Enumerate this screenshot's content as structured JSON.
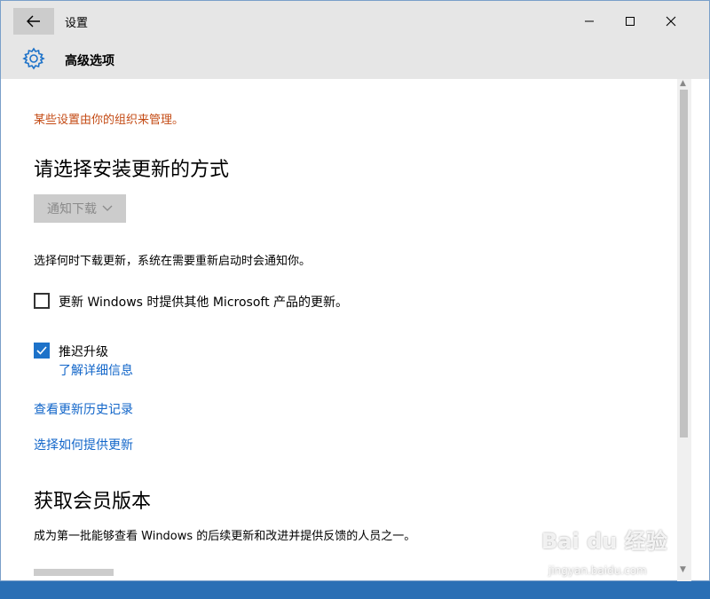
{
  "window": {
    "app_title": "设置",
    "page_title": "高级选项"
  },
  "notice": "某些设置由你的组织来管理。",
  "update_method": {
    "heading": "请选择安装更新的方式",
    "dropdown_value": "通知下载",
    "description": "选择何时下载更新，系统在需要重新启动时会通知你。"
  },
  "options": [
    {
      "label": "更新 Windows 时提供其他 Microsoft 产品的更新。",
      "checked": false
    },
    {
      "label": "推迟升级",
      "checked": true
    }
  ],
  "links": {
    "learn_more": "了解详细信息",
    "view_history": "查看更新历史记录",
    "choose_delivery": "选择如何提供更新"
  },
  "insider": {
    "heading": "获取会员版本",
    "description": "成为第一批能够查看 Windows 的后续更新和改进并提供反馈的人员之一。"
  },
  "watermark": {
    "logo_text": "Bai du 经验",
    "url": "jingyan.baidu.com"
  },
  "colors": {
    "accent": "#1d72c9",
    "link": "#1266c9",
    "warning": "#c44b15",
    "titlebar": "#e6e6e6"
  }
}
